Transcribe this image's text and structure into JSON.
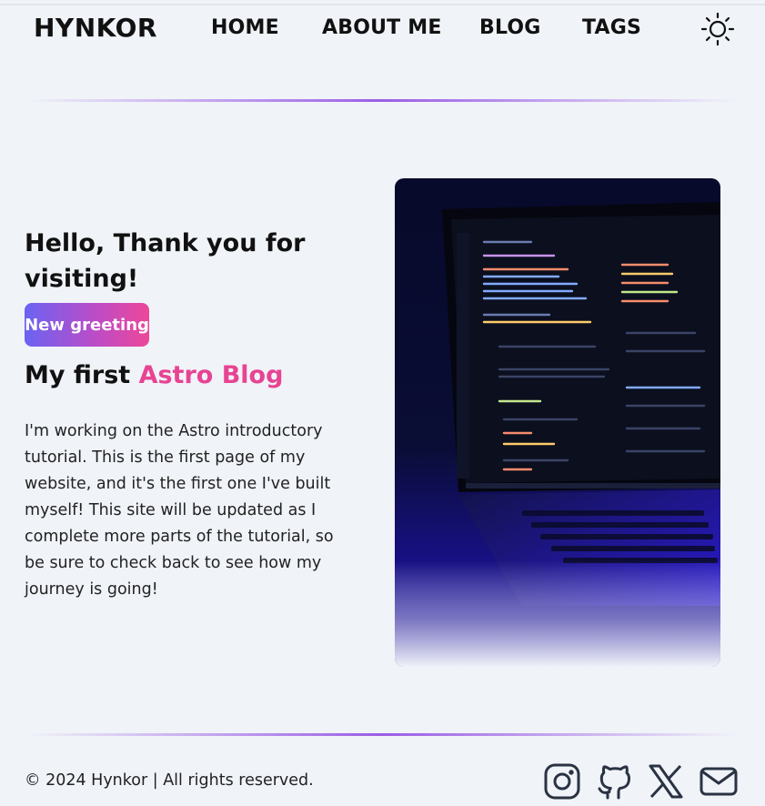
{
  "brand": "HYNKOR",
  "nav": {
    "links": [
      "HOME",
      "ABOUT ME",
      "BLOG",
      "TAGS"
    ]
  },
  "theme_toggle_icon": "sun-icon",
  "hero": {
    "title": "Hello, Thank you for visiting!",
    "greeting_button": "New greeting",
    "subtitle_prefix": "My first ",
    "subtitle_accent": "Astro Blog",
    "intro": "I'm working on the Astro introductory tutorial. This is the first page of my website, and it's the first one I've built myself! This site will be updated as I complete more parts of the tutorial, so be sure to check back to see how my journey is going!"
  },
  "footer": {
    "copyright": "© 2024 Hynkor | All rights reserved.",
    "social_icons": [
      "instagram-icon",
      "github-icon",
      "x-icon",
      "mail-icon"
    ]
  },
  "colors": {
    "background": "#f0f3f8",
    "accent_pink": "#e84393",
    "divider_purple": "#9b5de5",
    "button_gradient_start": "#6b63f2",
    "button_gradient_end": "#ec4899",
    "icon_stroke": "#2a3343"
  }
}
